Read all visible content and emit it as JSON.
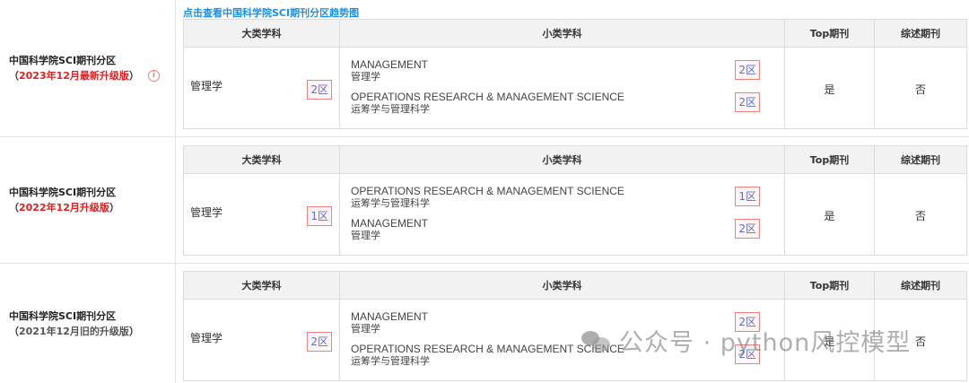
{
  "trend_link": "点击查看中国科学院SCI期刊分区趋势图",
  "headers": {
    "major": "大类学科",
    "minor": "小类学科",
    "top": "Top期刊",
    "review": "综述期刊"
  },
  "sections": [
    {
      "title": "中国科学院SCI期刊分区",
      "version_open": "（",
      "version": "2023年12月最新升级版",
      "version_close": "）",
      "major": {
        "name": "管理学",
        "zone": "2区"
      },
      "minors": [
        {
          "en": "MANAGEMENT",
          "cn": "管理学",
          "zone": "2区"
        },
        {
          "en": "OPERATIONS RESEARCH & MANAGEMENT SCIENCE",
          "cn": "运筹学与管理科学",
          "zone": "2区"
        }
      ],
      "top": "是",
      "review": "否"
    },
    {
      "title": "中国科学院SCI期刊分区",
      "version_open": "（",
      "version": "2022年12月升级版",
      "version_close": "）",
      "major": {
        "name": "管理学",
        "zone": "1区"
      },
      "minors": [
        {
          "en": "OPERATIONS RESEARCH & MANAGEMENT SCIENCE",
          "cn": "运筹学与管理科学",
          "zone": "1区"
        },
        {
          "en": "MANAGEMENT",
          "cn": "管理学",
          "zone": "2区"
        }
      ],
      "top": "是",
      "review": "否"
    },
    {
      "title": "中国科学院SCI期刊分区",
      "version_open": "（",
      "version": "2021年12月旧的升级版",
      "version_close": "）",
      "major": {
        "name": "管理学",
        "zone": "2区"
      },
      "minors": [
        {
          "en": "MANAGEMENT",
          "cn": "管理学",
          "zone": "2区"
        },
        {
          "en": "OPERATIONS RESEARCH & MANAGEMENT SCIENCE",
          "cn": "运筹学与管理科学",
          "zone": "2区"
        }
      ],
      "top": "是",
      "review": "否"
    }
  ],
  "watermark": "公众号 · python风控模型",
  "colors": {
    "version_current": "#e02020",
    "version_old": "#555555",
    "link": "#1a8ee8"
  }
}
